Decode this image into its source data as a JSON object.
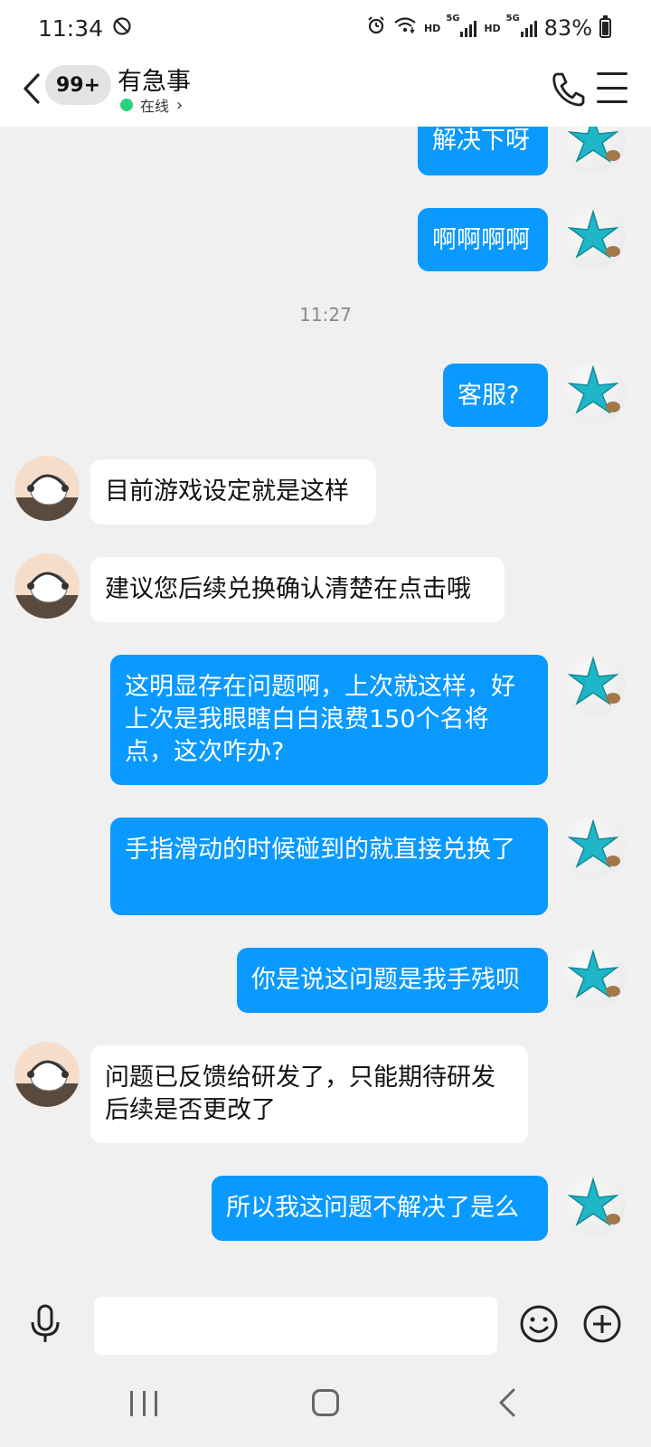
{
  "status": {
    "time": "11:34",
    "hd1": "HD",
    "hd2": "HD",
    "net1": "5G",
    "net2": "5G",
    "battery": "83%"
  },
  "header": {
    "unread_badge": "99+",
    "contact_name": "有急事",
    "online_status": "在线",
    "online_chevron": "›"
  },
  "messages": [
    {
      "dir": "out",
      "text": "解决下呀"
    },
    {
      "dir": "out",
      "text": "啊啊啊啊"
    },
    {
      "dir": "time",
      "text": "11:27"
    },
    {
      "dir": "out",
      "text": "客服?"
    },
    {
      "dir": "in",
      "text": "目前游戏设定就是这样"
    },
    {
      "dir": "in",
      "text": "建议您后续兑换确认清楚在点击哦"
    },
    {
      "dir": "out",
      "text": "这明显存在问题啊，上次就这样，好上次是我眼瞎白白浪费150个名将点，这次咋办?"
    },
    {
      "dir": "out",
      "text": "手指滑动的时候碰到的就直接兑换了"
    },
    {
      "dir": "out",
      "text": "你是说这问题是我手残呗"
    },
    {
      "dir": "in",
      "text": "问题已反馈给研发了，只能期待研发后续是否更改了"
    },
    {
      "dir": "out",
      "text": "所以我这问题不解决了是么"
    }
  ],
  "input": {
    "value": "",
    "placeholder": ""
  },
  "icons": {
    "mute": "alarm-muted-icon",
    "alarm": "alarm-icon",
    "wifi": "wifi-icon",
    "signal": "signal-icon",
    "battery": "battery-icon",
    "back": "chevron-left-icon",
    "phone": "phone-icon",
    "menu": "menu-icon",
    "mic": "microphone-icon",
    "emoji": "emoji-icon",
    "plus": "plus-icon"
  },
  "colors": {
    "outgoing_bubble": "#0a99ff",
    "incoming_bubble": "#ffffff",
    "chat_background": "#f0f0f0",
    "online_dot": "#2ad17f"
  }
}
